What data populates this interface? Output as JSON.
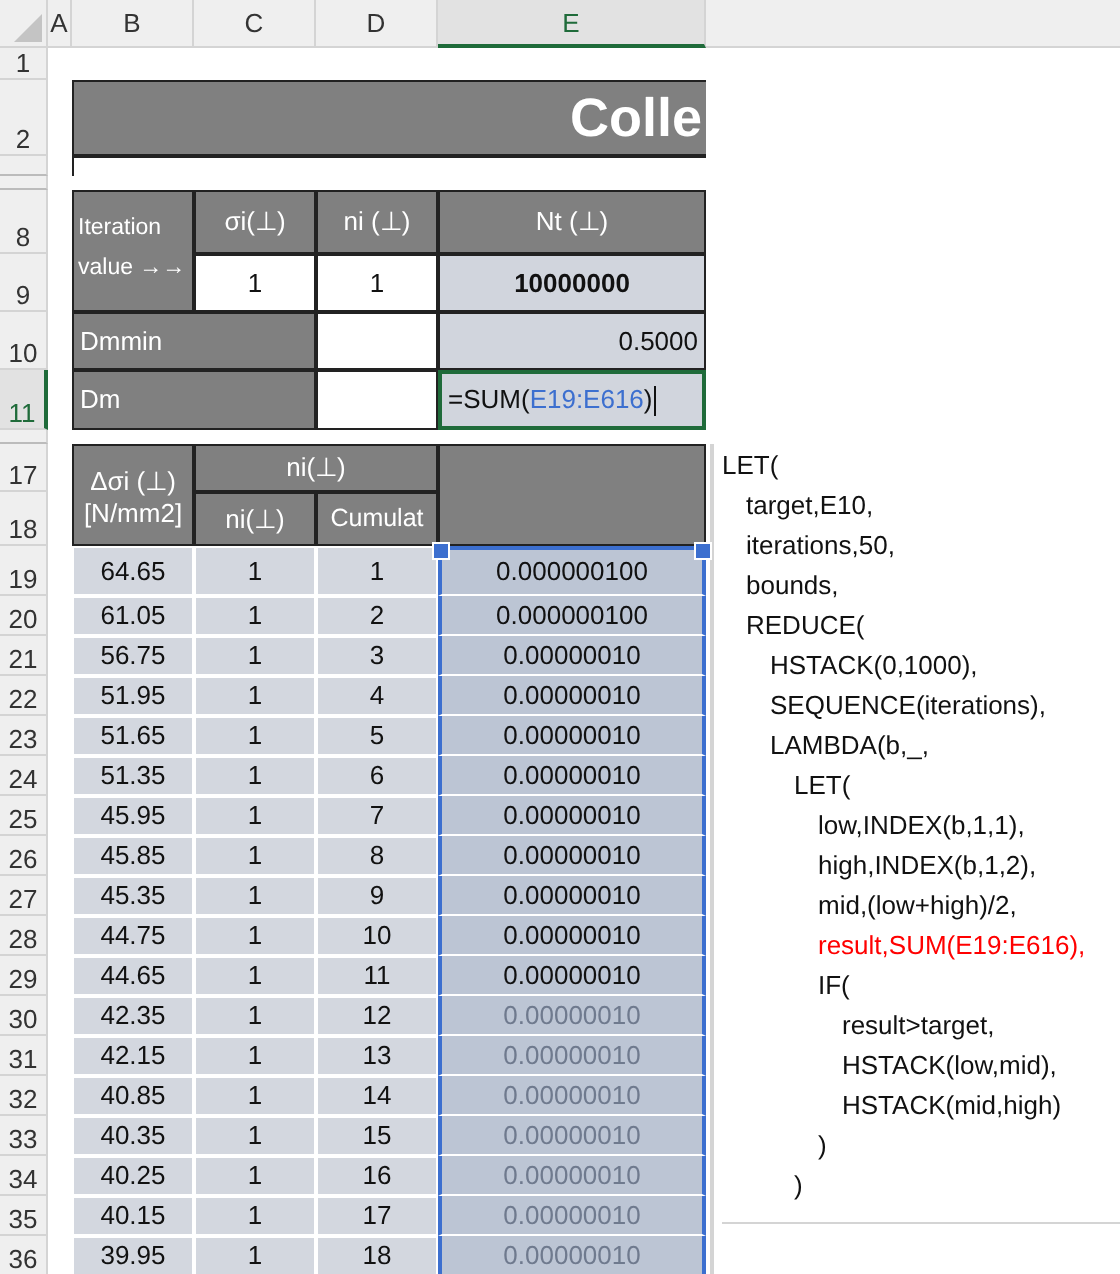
{
  "column_headers": [
    {
      "label": "A",
      "selected": false
    },
    {
      "label": "B",
      "selected": false
    },
    {
      "label": "C",
      "selected": false
    },
    {
      "label": "D",
      "selected": false
    },
    {
      "label": "E",
      "selected": true
    }
  ],
  "row_headers": [
    {
      "label": "1",
      "selected": false
    },
    {
      "label": "2",
      "selected": false
    },
    {
      "label": "8",
      "selected": false
    },
    {
      "label": "9",
      "selected": false
    },
    {
      "label": "10",
      "selected": false
    },
    {
      "label": "11",
      "selected": true
    },
    {
      "label": "17",
      "selected": false
    },
    {
      "label": "18",
      "selected": false
    },
    {
      "label": "19",
      "selected": false
    },
    {
      "label": "20",
      "selected": false
    },
    {
      "label": "21",
      "selected": false
    },
    {
      "label": "22",
      "selected": false
    },
    {
      "label": "23",
      "selected": false
    },
    {
      "label": "24",
      "selected": false
    },
    {
      "label": "25",
      "selected": false
    },
    {
      "label": "26",
      "selected": false
    },
    {
      "label": "27",
      "selected": false
    },
    {
      "label": "28",
      "selected": false
    },
    {
      "label": "29",
      "selected": false
    },
    {
      "label": "30",
      "selected": false
    },
    {
      "label": "31",
      "selected": false
    },
    {
      "label": "32",
      "selected": false
    },
    {
      "label": "33",
      "selected": false
    },
    {
      "label": "34",
      "selected": false
    },
    {
      "label": "35",
      "selected": false
    },
    {
      "label": "36",
      "selected": false
    }
  ],
  "title": "Colle",
  "params": {
    "label": "Iteration value →→",
    "headers": [
      "σi(⊥)",
      "ni (⊥)",
      "Nt (⊥)"
    ],
    "values": [
      "1",
      "1",
      "10000000"
    ],
    "dmmin": {
      "label": "Dmmin",
      "value": "0.5000"
    },
    "dm": {
      "label": "Dm",
      "formula": {
        "prefix": "=SUM(",
        "ref": "E19:E616",
        "suffix": ")"
      },
      "editing": true
    }
  },
  "table": {
    "headers": {
      "stress": "Δσi (⊥) [N/mm2]",
      "group": "ni(⊥)",
      "ni": "ni(⊥)",
      "cumulative": "Cumulat"
    },
    "rows": [
      {
        "stress": "64.65",
        "ni": "1",
        "cumulative": "1",
        "value": "0.000000100",
        "dimmed": false
      },
      {
        "stress": "61.05",
        "ni": "1",
        "cumulative": "2",
        "value": "0.000000100",
        "dimmed": false
      },
      {
        "stress": "56.75",
        "ni": "1",
        "cumulative": "3",
        "value": "0.00000010",
        "dimmed": false
      },
      {
        "stress": "51.95",
        "ni": "1",
        "cumulative": "4",
        "value": "0.00000010",
        "dimmed": false
      },
      {
        "stress": "51.65",
        "ni": "1",
        "cumulative": "5",
        "value": "0.00000010",
        "dimmed": false
      },
      {
        "stress": "51.35",
        "ni": "1",
        "cumulative": "6",
        "value": "0.00000010",
        "dimmed": false
      },
      {
        "stress": "45.95",
        "ni": "1",
        "cumulative": "7",
        "value": "0.00000010",
        "dimmed": false
      },
      {
        "stress": "45.85",
        "ni": "1",
        "cumulative": "8",
        "value": "0.00000010",
        "dimmed": false
      },
      {
        "stress": "45.35",
        "ni": "1",
        "cumulative": "9",
        "value": "0.00000010",
        "dimmed": false
      },
      {
        "stress": "44.75",
        "ni": "1",
        "cumulative": "10",
        "value": "0.00000010",
        "dimmed": false
      },
      {
        "stress": "44.65",
        "ni": "1",
        "cumulative": "11",
        "value": "0.00000010",
        "dimmed": false
      },
      {
        "stress": "42.35",
        "ni": "1",
        "cumulative": "12",
        "value": "0.00000010",
        "dimmed": true
      },
      {
        "stress": "42.15",
        "ni": "1",
        "cumulative": "13",
        "value": "0.00000010",
        "dimmed": true
      },
      {
        "stress": "40.85",
        "ni": "1",
        "cumulative": "14",
        "value": "0.00000010",
        "dimmed": true
      },
      {
        "stress": "40.35",
        "ni": "1",
        "cumulative": "15",
        "value": "0.00000010",
        "dimmed": true
      },
      {
        "stress": "40.25",
        "ni": "1",
        "cumulative": "16",
        "value": "0.00000010",
        "dimmed": true
      },
      {
        "stress": "40.15",
        "ni": "1",
        "cumulative": "17",
        "value": "0.00000010",
        "dimmed": true
      },
      {
        "stress": "39.95",
        "ni": "1",
        "cumulative": "18",
        "value": "0.00000010",
        "dimmed": true
      }
    ]
  },
  "code": [
    {
      "text": "LET(",
      "highlighted": false,
      "children": [
        {
          "text": "target,E10,",
          "highlighted": false
        },
        {
          "text": "iterations,50,",
          "highlighted": false
        },
        {
          "text": "bounds,",
          "highlighted": false
        },
        {
          "text": "REDUCE(",
          "highlighted": false,
          "children": [
            {
              "text": "HSTACK(0,1000),",
              "highlighted": false
            },
            {
              "text": "SEQUENCE(iterations),",
              "highlighted": false
            },
            {
              "text": "LAMBDA(b,_,",
              "highlighted": false,
              "children": [
                {
                  "text": "LET(",
                  "highlighted": false,
                  "children": [
                    {
                      "text": "low,INDEX(b,1,1),",
                      "highlighted": false
                    },
                    {
                      "text": "high,INDEX(b,1,2),",
                      "highlighted": false
                    },
                    {
                      "text": "mid,(low+high)/2,",
                      "highlighted": false
                    },
                    {
                      "text": "result,SUM(E19:E616),",
                      "highlighted": true
                    },
                    {
                      "text": "IF(",
                      "highlighted": false,
                      "children": [
                        {
                          "text": "result>target,",
                          "highlighted": false
                        },
                        {
                          "text": "HSTACK(low,mid),",
                          "highlighted": false
                        },
                        {
                          "text": "HSTACK(mid,high)",
                          "highlighted": false
                        }
                      ]
                    },
                    {
                      "text": ")",
                      "highlighted": false
                    }
                  ]
                },
                {
                  "text": ")",
                  "highlighted": false
                }
              ]
            }
          ]
        }
      ]
    }
  ]
}
